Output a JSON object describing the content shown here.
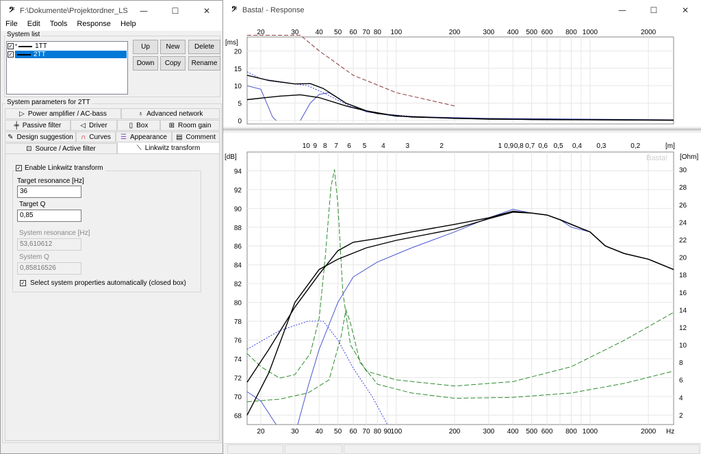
{
  "left_window": {
    "title": "F:\\Dokumente\\Projektordner_LS\\SC...",
    "menu": [
      "File",
      "Edit",
      "Tools",
      "Response",
      "Help"
    ],
    "system_list_label": "System list",
    "systems": [
      {
        "name": "1TT",
        "checked": true,
        "selected": false,
        "marker": "*"
      },
      {
        "name": "2TT",
        "checked": true,
        "selected": true,
        "marker": ""
      }
    ],
    "buttons": {
      "up": "Up",
      "new": "New",
      "delete": "Delete",
      "down": "Down",
      "copy": "Copy",
      "rename": "Rename"
    },
    "params_label": "System parameters for 2TT",
    "tabs": {
      "power_amp": "Power amplifier / AC-bass",
      "advanced_network": "Advanced network",
      "passive_filter": "Passive filter",
      "driver": "Driver",
      "box": "Box",
      "room_gain": "Room gain",
      "design_suggestion": "Design suggestion",
      "curves": "Curves",
      "appearance": "Appearance",
      "comment": "Comment",
      "source_active": "Source / Active filter",
      "linkwitz": "Linkwitz transform"
    },
    "linkwitz": {
      "enable_label": "Enable Linkwitz transform",
      "enabled": true,
      "target_resonance_label": "Target resonance [Hz]",
      "target_resonance": "36",
      "target_q_label": "Target Q",
      "target_q": "0,85",
      "system_resonance_label": "System resonance [Hz]",
      "system_resonance": "53,610612",
      "system_q_label": "System Q",
      "system_q": "0,85816526",
      "auto_label": "Select system properties automatically (closed box)",
      "auto_checked": true
    }
  },
  "right_window": {
    "title": "Basta! - Response",
    "top_chart": {
      "freq_ticks": [
        "20",
        "30",
        "40",
        "50",
        "60",
        "70",
        "80",
        "100",
        "200",
        "300",
        "400",
        "500",
        "600",
        "800",
        "1000",
        "2000"
      ],
      "unit": "[ms]",
      "y_ticks": [
        "20",
        "15",
        "10",
        "5",
        "0"
      ]
    },
    "bottom_chart": {
      "wavelength_ticks": [
        "10",
        "9",
        "8",
        "7",
        "6",
        "5",
        "4",
        "3",
        "2",
        "1",
        "0,9",
        "0,8",
        "0,7",
        "0,6",
        "0,5",
        "0,4",
        "0,3",
        "0,2"
      ],
      "wavelength_unit": "[m]",
      "db_unit": "[dB]",
      "ohm_unit": "[Ohm]",
      "watermark": "Basta!",
      "db_ticks": [
        "94",
        "92",
        "90",
        "88",
        "86",
        "84",
        "82",
        "80",
        "78",
        "76",
        "74",
        "72",
        "70",
        "68"
      ],
      "ohm_ticks": [
        "30",
        "28",
        "26",
        "24",
        "22",
        "20",
        "18",
        "16",
        "14",
        "12",
        "10",
        "8",
        "6",
        "4",
        "2"
      ],
      "freq_ticks": [
        "20",
        "30",
        "40",
        "50",
        "60",
        "70",
        "80",
        "90",
        "100",
        "200",
        "300",
        "400",
        "500",
        "600",
        "800",
        "1000",
        "2000"
      ],
      "hz_unit": "Hz"
    },
    "colors": {
      "black": "#000000",
      "blue": "#4a55d0",
      "green": "#2e8b2e",
      "red_dash": "#8b3a3a",
      "dotted_blue": "#3a40e0"
    }
  }
}
